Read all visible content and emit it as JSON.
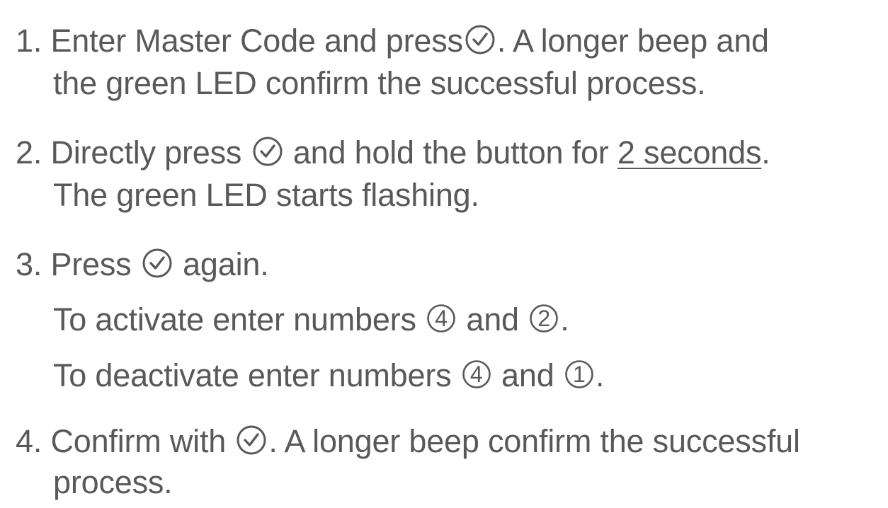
{
  "steps": [
    {
      "number": "1.",
      "line1_a": "Enter Master Code and press",
      "line1_b": ". A longer beep and",
      "line2": "the green LED confirm the successful process."
    },
    {
      "number": "2.",
      "line1_a": "Directly press",
      "line1_b": "and hold the button for",
      "line1_emph": "2 seconds",
      "line1_end": ".",
      "line2": "The green LED starts flashing."
    },
    {
      "number": "3.",
      "line1_a": "Press",
      "line1_b": "again.",
      "activate_a": "To activate enter numbers",
      "activate_n1": "4",
      "activate_mid": "and",
      "activate_n2": "2",
      "activate_end": ".",
      "deactivate_a": "To deactivate enter numbers",
      "deactivate_n1": "4",
      "deactivate_mid": "and",
      "deactivate_n2": "1",
      "deactivate_end": "."
    },
    {
      "number": "4.",
      "line1_a": "Confirm with",
      "line1_b": ". A longer beep confirm the successful",
      "line2": "process."
    }
  ],
  "icons": {
    "confirm": "check-circle-icon",
    "number": "circled-number-icon"
  },
  "colors": {
    "text": "#58595b",
    "background": "#ffffff"
  }
}
